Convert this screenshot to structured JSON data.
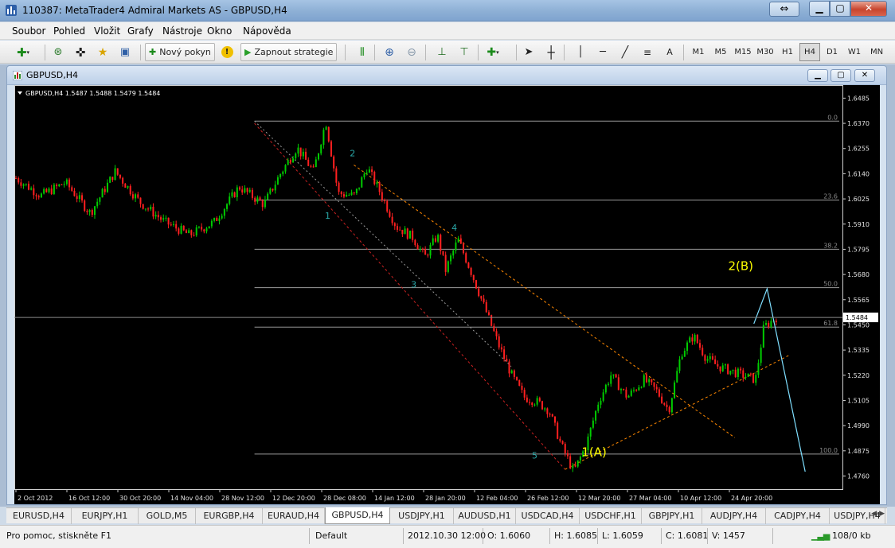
{
  "window": {
    "title": "110387: MetaTrader4 Admiral Markets AS - GBPUSD,H4"
  },
  "menu": [
    "Soubor",
    "Pohled",
    "Vložit",
    "Grafy",
    "Nástroje",
    "Okno",
    "Nápověda"
  ],
  "toolbar": {
    "new_order": "Nový pokyn",
    "autotrading": "Zapnout strategie",
    "text_tool": "A",
    "timeframes": [
      "M1",
      "M5",
      "M15",
      "M30",
      "H1",
      "H4",
      "D1",
      "W1",
      "MN"
    ],
    "active_timeframe": "H4"
  },
  "chart_window": {
    "title": "GBPUSD,H4"
  },
  "chart_data": {
    "type": "candlestick",
    "header": "GBPUSD,H4  1.5487 1.5488 1.5479 1.5484",
    "symbol": "GBPUSD",
    "timeframe": "H4",
    "ylim": [
      1.47,
      1.653
    ],
    "y_ticks": [
      "1.6485",
      "1.6370",
      "1.6255",
      "1.6140",
      "1.6025",
      "1.5910",
      "1.5795",
      "1.5680",
      "1.5565",
      "1.5450",
      "1.5335",
      "1.5220",
      "1.5105",
      "1.4990",
      "1.4875",
      "1.4760"
    ],
    "x_ticks": [
      "2 Oct 2012",
      "16 Oct 12:00",
      "30 Oct 20:00",
      "14 Nov 04:00",
      "28 Nov 12:00",
      "12 Dec 20:00",
      "28 Dec 08:00",
      "14 Jan 12:00",
      "28 Jan 20:00",
      "12 Feb 04:00",
      "26 Feb 12:00",
      "12 Mar 20:00",
      "27 Mar 04:00",
      "10 Apr 12:00",
      "24 Apr 20:00"
    ],
    "current_price": "1.5484",
    "price_path": [
      [
        0.0,
        1.612
      ],
      [
        0.03,
        1.604
      ],
      [
        0.06,
        1.61
      ],
      [
        0.09,
        1.596
      ],
      [
        0.12,
        1.615
      ],
      [
        0.15,
        1.601
      ],
      [
        0.18,
        1.592
      ],
      [
        0.21,
        1.586
      ],
      [
        0.24,
        1.592
      ],
      [
        0.27,
        1.608
      ],
      [
        0.3,
        1.6
      ],
      [
        0.32,
        1.614
      ],
      [
        0.34,
        1.626
      ],
      [
        0.36,
        1.615
      ],
      [
        0.375,
        1.638
      ],
      [
        0.39,
        1.605
      ],
      [
        0.41,
        1.604
      ],
      [
        0.425,
        1.617
      ],
      [
        0.44,
        1.606
      ],
      [
        0.46,
        1.59
      ],
      [
        0.48,
        1.585
      ],
      [
        0.495,
        1.576
      ],
      [
        0.51,
        1.586
      ],
      [
        0.52,
        1.57
      ],
      [
        0.535,
        1.584
      ],
      [
        0.55,
        1.57
      ],
      [
        0.57,
        1.55
      ],
      [
        0.585,
        1.535
      ],
      [
        0.6,
        1.522
      ],
      [
        0.615,
        1.512
      ],
      [
        0.63,
        1.51
      ],
      [
        0.645,
        1.506
      ],
      [
        0.66,
        1.49
      ],
      [
        0.675,
        1.478
      ],
      [
        0.69,
        1.49
      ],
      [
        0.705,
        1.51
      ],
      [
        0.72,
        1.522
      ],
      [
        0.74,
        1.512
      ],
      [
        0.76,
        1.52
      ],
      [
        0.775,
        1.515
      ],
      [
        0.79,
        1.506
      ],
      [
        0.805,
        1.532
      ],
      [
        0.82,
        1.54
      ],
      [
        0.835,
        1.53
      ],
      [
        0.85,
        1.526
      ],
      [
        0.865,
        1.524
      ],
      [
        0.88,
        1.522
      ],
      [
        0.895,
        1.52
      ],
      [
        0.905,
        1.544
      ],
      [
        0.92,
        1.5484
      ]
    ],
    "fibonacci_levels": [
      {
        "label": "0.0",
        "price": 1.638
      },
      {
        "label": "23.6",
        "price": 1.602
      },
      {
        "label": "38.2",
        "price": 1.5795
      },
      {
        "label": "50.0",
        "price": 1.562
      },
      {
        "label": "61.8",
        "price": 1.544
      },
      {
        "label": "100.0",
        "price": 1.486
      }
    ],
    "wave_labels": [
      {
        "text": "1",
        "x": 0.375,
        "price": 1.5935
      },
      {
        "text": "2",
        "x": 0.405,
        "price": 1.622
      },
      {
        "text": "3",
        "x": 0.479,
        "price": 1.562
      },
      {
        "text": "4",
        "x": 0.528,
        "price": 1.588
      },
      {
        "text": "5",
        "x": 0.625,
        "price": 1.484
      },
      {
        "text": "1(A)",
        "x": 0.685,
        "price": 1.485
      },
      {
        "text": "2(B)",
        "x": 0.862,
        "price": 1.57
      }
    ],
    "forecast_path": [
      [
        0.893,
        1.5455
      ],
      [
        0.909,
        1.5615
      ],
      [
        0.955,
        1.478
      ]
    ],
    "colors": {
      "up": "#00cc00",
      "down": "#ff2020",
      "fib": "#9a9a9a",
      "wave_minor": "#2aa8a8",
      "wave_major": "#ffff00",
      "forecast": "#7fdfff",
      "channel_lower": "#cc2222",
      "channel_upper": "#ff8800"
    }
  },
  "symbol_tabs": [
    "EURUSD,H4",
    "EURJPY,H1",
    "GOLD,M5",
    "EURGBP,H4",
    "EURAUD,H4",
    "GBPUSD,H4",
    "USDJPY,H1",
    "AUDUSD,H1",
    "USDCAD,H4",
    "USDCHF,H1",
    "GBPJPY,H1",
    "AUDJPY,H4",
    "CADJPY,H4",
    "USDJPY,H4"
  ],
  "active_tab": "GBPUSD,H4",
  "status": {
    "help": "Pro pomoc, stiskněte F1",
    "profile": "Default",
    "datetime": "2012.10.30 12:00",
    "open": "O: 1.6060",
    "high": "H: 1.6085",
    "low": "L: 1.6059",
    "close": "C: 1.6081",
    "volume": "V: 1457",
    "traffic": "108/0 kb"
  }
}
